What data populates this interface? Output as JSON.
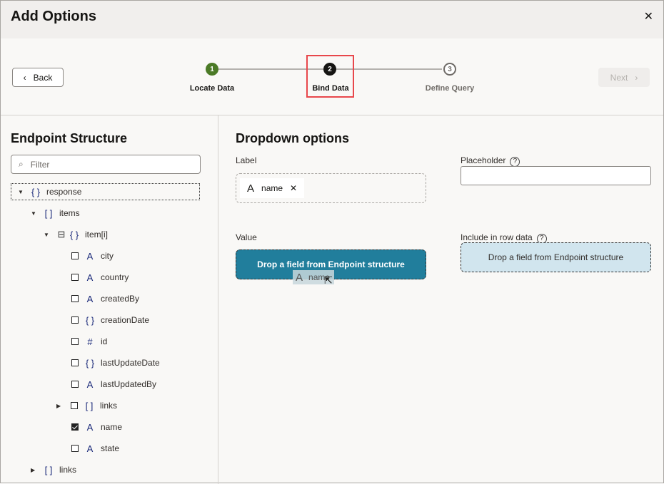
{
  "dialog": {
    "title": "Add Options",
    "close_icon": "close-icon"
  },
  "nav": {
    "back": "Back",
    "next": "Next"
  },
  "steps": [
    {
      "num": "1",
      "label": "Locate Data",
      "state": "complete",
      "color": "#4b7a26"
    },
    {
      "num": "2",
      "label": "Bind Data",
      "state": "current",
      "color": "#161513"
    },
    {
      "num": "3",
      "label": "Define Query",
      "state": "upcoming"
    }
  ],
  "left": {
    "heading": "Endpoint Structure",
    "filter_placeholder": "Filter",
    "tree": [
      {
        "label": "response",
        "icon": "{ }",
        "expanded": true
      },
      {
        "label": "items",
        "icon": "[ ]",
        "expanded": true
      },
      {
        "label": "item[i]",
        "icon": "{ }",
        "expanded": true
      },
      {
        "label": "city",
        "icon": "A",
        "checked": false
      },
      {
        "label": "country",
        "icon": "A",
        "checked": false
      },
      {
        "label": "createdBy",
        "icon": "A",
        "checked": false
      },
      {
        "label": "creationDate",
        "icon": "{ }",
        "checked": false
      },
      {
        "label": "id",
        "icon": "#",
        "checked": false
      },
      {
        "label": "lastUpdateDate",
        "icon": "{ }",
        "checked": false
      },
      {
        "label": "lastUpdatedBy",
        "icon": "A",
        "checked": false
      },
      {
        "label": "links",
        "icon": "[ ]",
        "checked": false,
        "expanded": false
      },
      {
        "label": "name",
        "icon": "A",
        "checked": true
      },
      {
        "label": "state",
        "icon": "A",
        "checked": false
      },
      {
        "label": "links",
        "icon": "[ ]",
        "expanded": false
      }
    ]
  },
  "right": {
    "heading": "Dropdown options",
    "label_field": "Label",
    "label_chip": "name",
    "placeholder_field": "Placeholder",
    "value_field": "Value",
    "value_drop": "Drop a field from Endpoint structure",
    "row_field": "Include in row data",
    "row_drop": "Drop a field from Endpoint structure",
    "drag_ghost": "name"
  }
}
